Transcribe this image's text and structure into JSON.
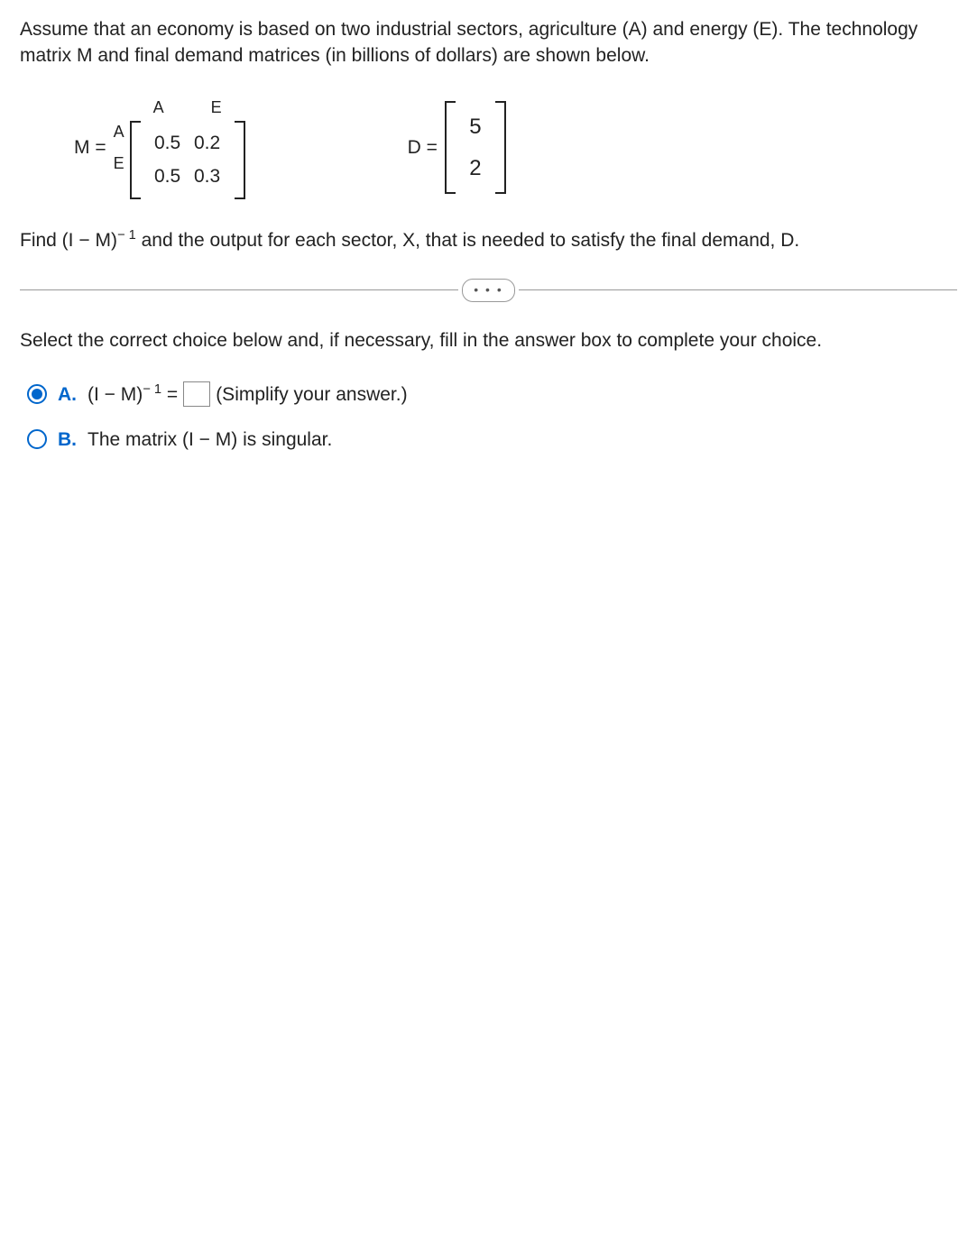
{
  "question": {
    "intro": "Assume that an economy is based on two industrial sectors, agriculture (A) and energy (E). The technology matrix M and final demand matrices (in billions of dollars) are shown below.",
    "matrix_M": {
      "label": "M =",
      "col_headers": [
        "A",
        "E"
      ],
      "row_headers": [
        "A",
        "E"
      ],
      "rows": [
        [
          "0.5",
          "0.2"
        ],
        [
          "0.5",
          "0.3"
        ]
      ]
    },
    "matrix_D": {
      "label": "D =",
      "rows": [
        [
          "5"
        ],
        [
          "2"
        ]
      ]
    },
    "instruction_prefix": "Find (I − M)",
    "instruction_exp": "− 1",
    "instruction_suffix": " and the output for each sector, X, that is needed to satisfy the final demand, D."
  },
  "divider_dots": "• • •",
  "select_text": "Select the correct choice below and, if necessary, fill in the answer box to complete your choice.",
  "choices": {
    "A": {
      "label": "A.",
      "text_prefix": "(I − M)",
      "text_exp": "− 1",
      "text_mid": " = ",
      "hint": "(Simplify your answer.)",
      "selected": true
    },
    "B": {
      "label": "B.",
      "text": "The matrix (I − M) is singular.",
      "selected": false
    }
  }
}
